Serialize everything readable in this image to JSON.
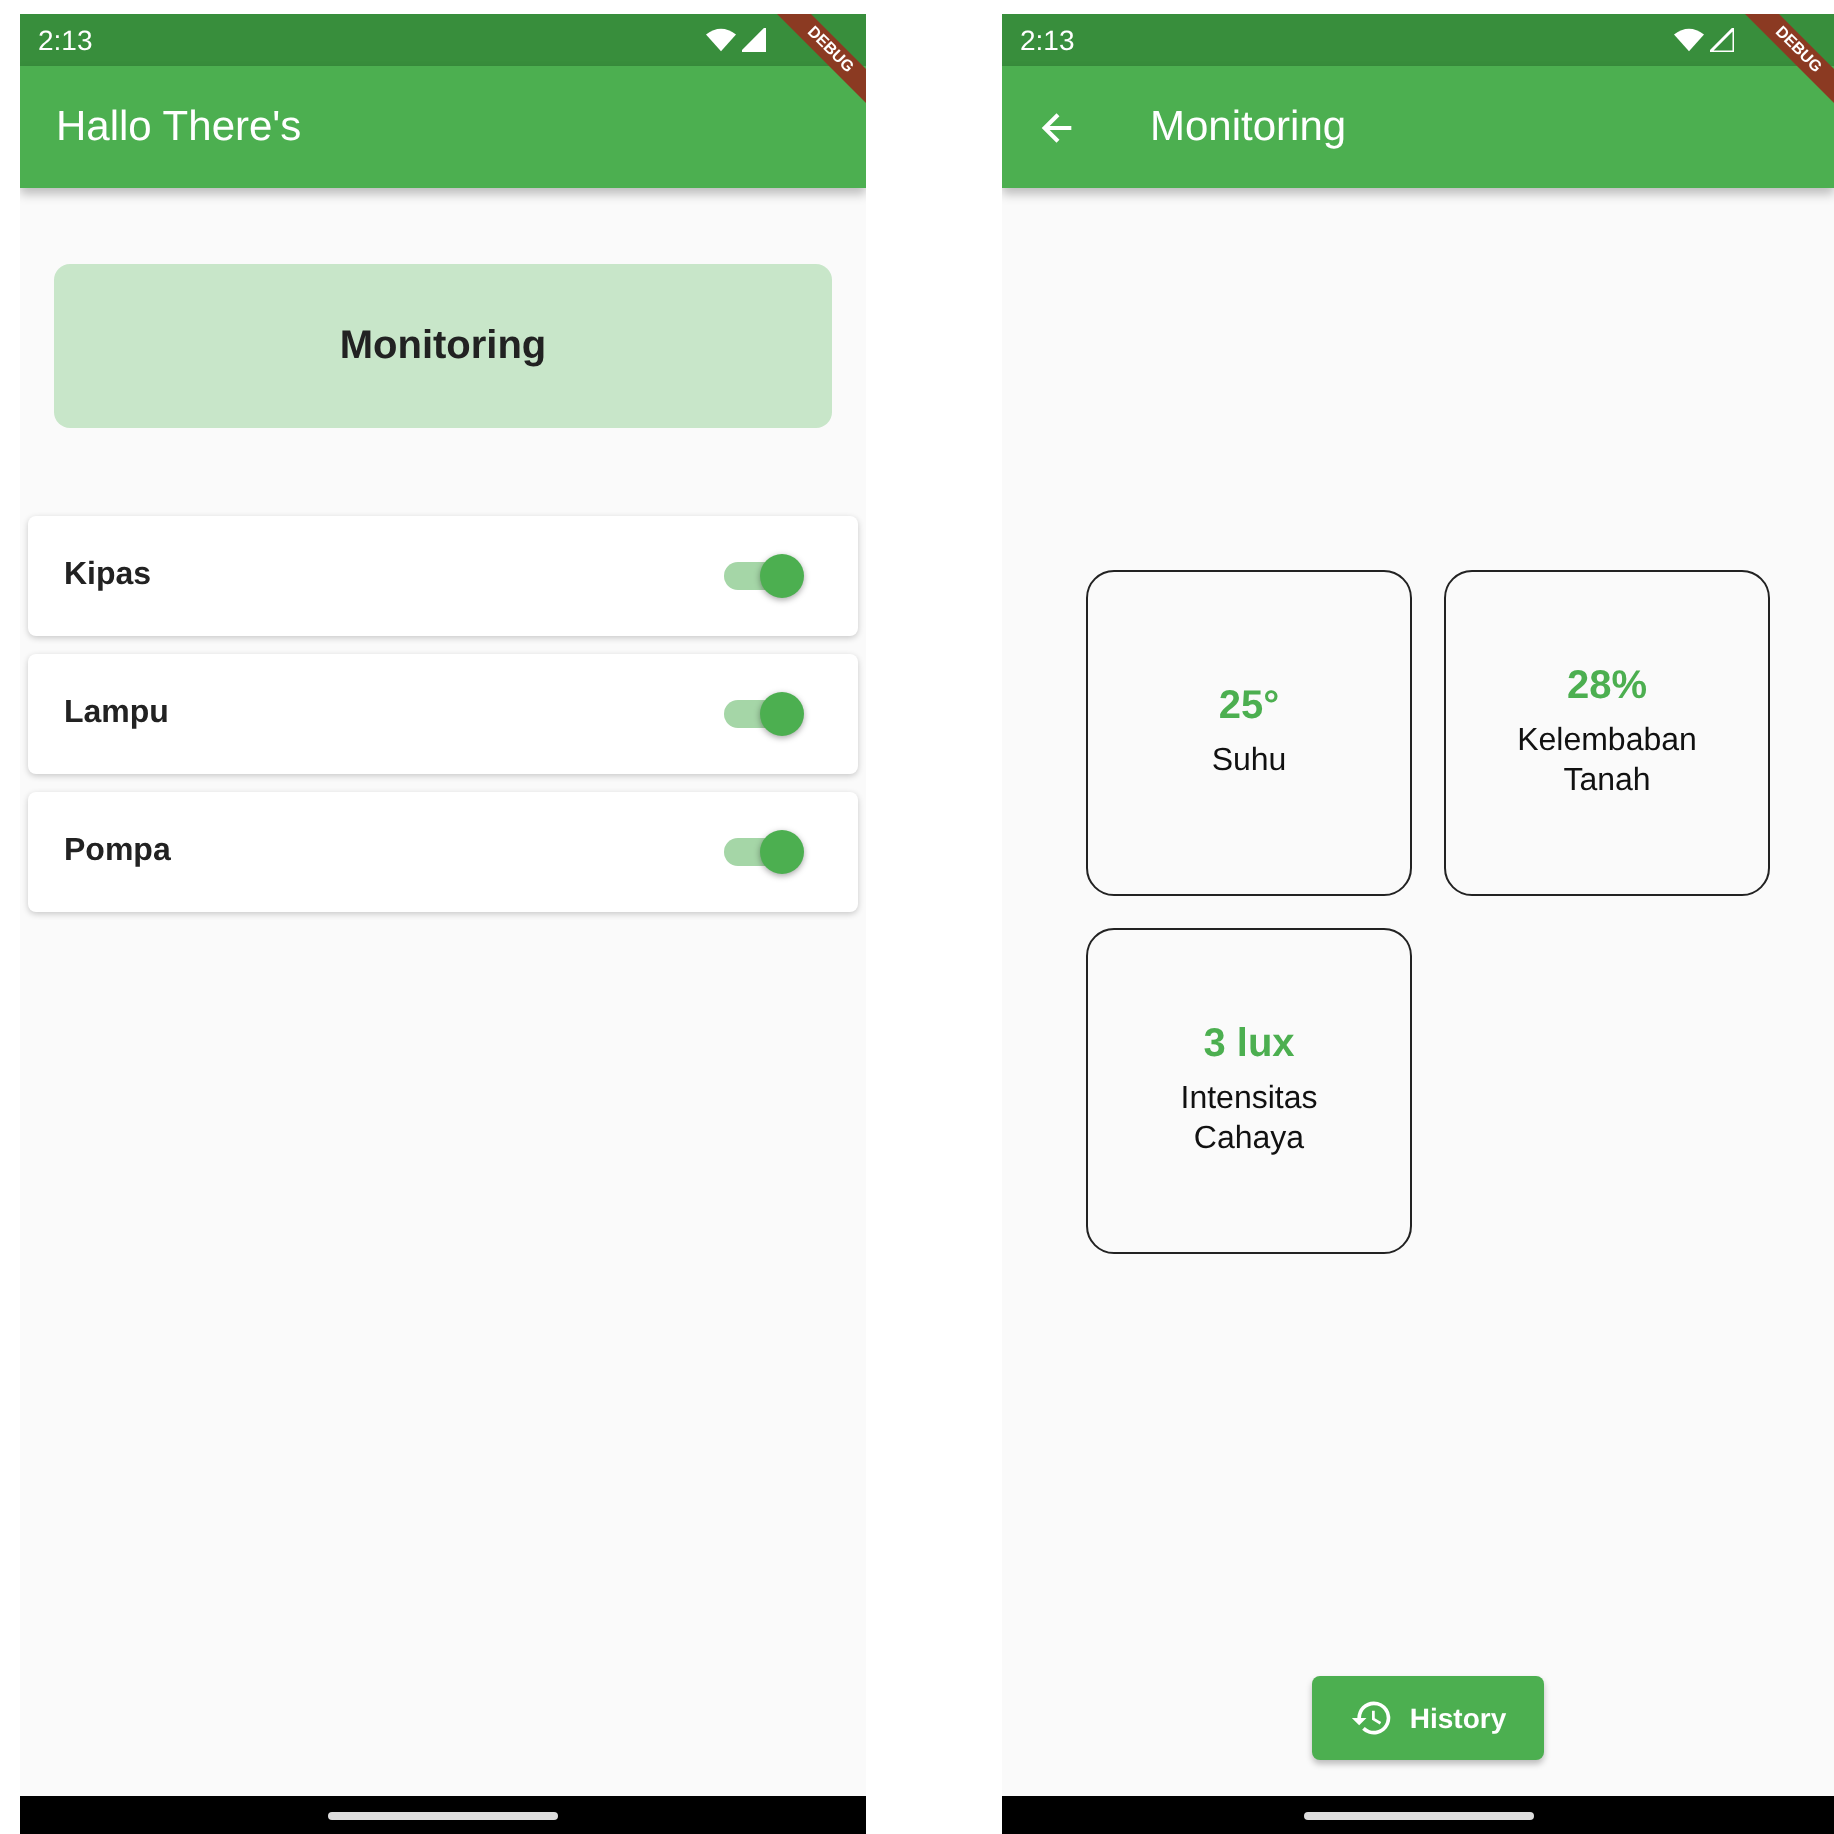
{
  "screens": [
    {
      "status_bar": {
        "time": "2:13"
      },
      "debug_banner": "DEBUG",
      "app_bar": {
        "title": "Hallo There's",
        "back": false
      },
      "monitoring_card": {
        "label": "Monitoring"
      },
      "devices": [
        {
          "name": "Kipas",
          "on": true
        },
        {
          "name": "Lampu",
          "on": true
        },
        {
          "name": "Pompa",
          "on": true
        }
      ]
    },
    {
      "status_bar": {
        "time": "2:13"
      },
      "debug_banner": "DEBUG",
      "app_bar": {
        "title": "Monitoring",
        "back": true
      },
      "sensors": [
        {
          "value": "25°",
          "label": "Suhu"
        },
        {
          "value": "28%",
          "label": "Kelembaban Tanah"
        },
        {
          "value": "3 lux",
          "label": "Intensitas Cahaya"
        }
      ],
      "history_button": {
        "label": "History"
      }
    }
  ]
}
